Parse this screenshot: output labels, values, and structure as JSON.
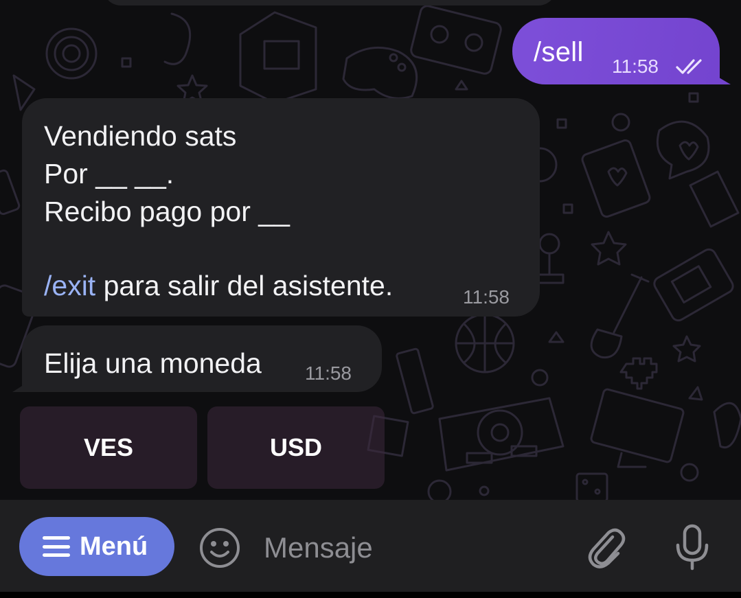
{
  "messages": {
    "outgoing": {
      "text": "/sell",
      "time": "11:58",
      "status_icon": "double-check-icon"
    },
    "incoming_1": {
      "line1": "Vendiendo sats",
      "line2": "Por __ __.",
      "line3": "Recibo pago por __",
      "exit_command": "/exit",
      "exit_rest": " para salir del asistente.",
      "time": "11:58"
    },
    "incoming_2": {
      "text": "Elija una moneda",
      "time": "11:58"
    }
  },
  "keyboard": {
    "buttons": [
      {
        "label": "VES"
      },
      {
        "label": "USD"
      }
    ]
  },
  "input_bar": {
    "menu_label": "Menú",
    "menu_icon": "hamburger-icon",
    "emoji_icon": "smiley-icon",
    "placeholder": "Mensaje",
    "attach_icon": "paperclip-icon",
    "mic_icon": "microphone-icon"
  },
  "colors": {
    "outgoing_bubble": "#7d4fd9",
    "incoming_bubble": "#212124",
    "link": "#9ab3f5",
    "menu_button": "#6678dc",
    "input_bar": "#1f1f21"
  }
}
